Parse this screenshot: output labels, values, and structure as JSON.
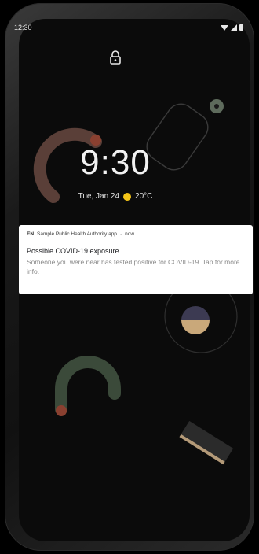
{
  "status_bar": {
    "time": "12:30",
    "icons": [
      "wifi-icon",
      "signal-icon",
      "battery-icon"
    ]
  },
  "lock": {
    "icon": "lock-icon"
  },
  "clock": {
    "time": "9:30",
    "date": "Tue, Jan 24",
    "weather_icon": "sun-icon",
    "temperature": "20°C"
  },
  "notification": {
    "badge": "EN",
    "app_name": "Sample Public Health Authority app",
    "separator": "·",
    "when": "now",
    "title": "Possible COVID-19 exposure",
    "body": "Someone you were near has tested positive for COVID-19. Tap for more info."
  },
  "colors": {
    "screen_bg": "#0b0b0b",
    "notification_bg": "#ffffff",
    "weather_sun": "#f5c518"
  }
}
